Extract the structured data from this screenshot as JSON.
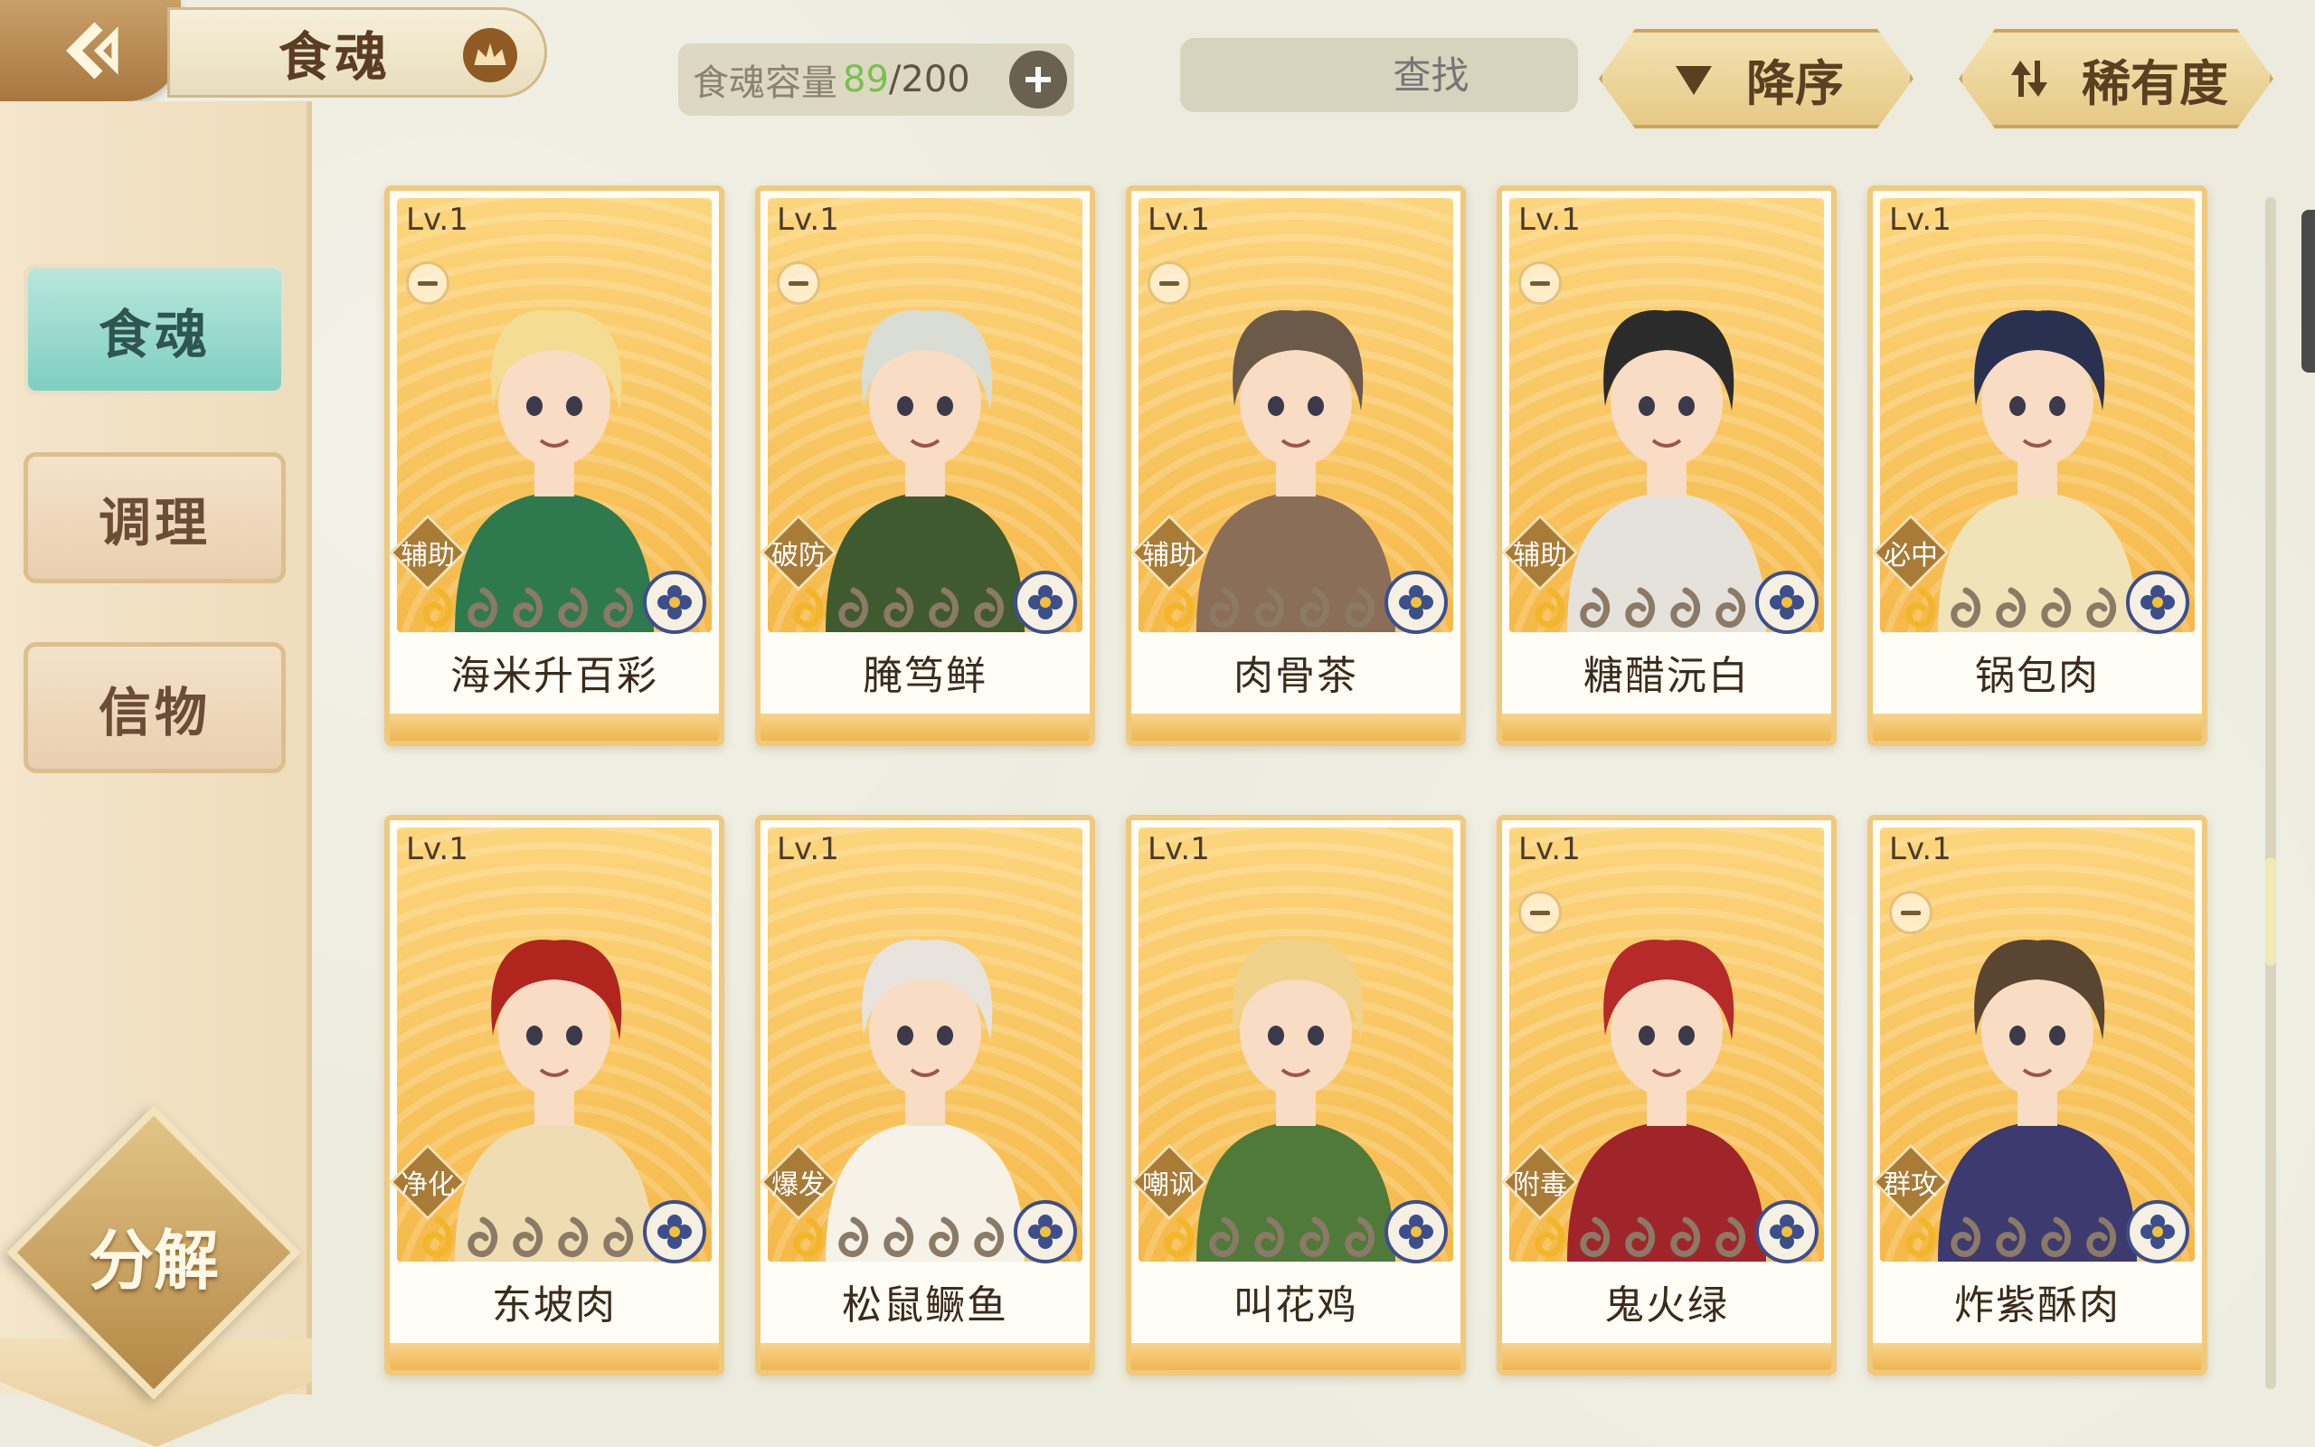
{
  "header": {
    "title": "食魂",
    "capacity_label": "食魂容量",
    "capacity_current": "89",
    "capacity_separator": "/",
    "capacity_max": "200",
    "search_placeholder": "查找",
    "sort_order_label": "降序",
    "sort_key_label": "稀有度"
  },
  "sidebar": {
    "tabs": [
      {
        "label": "食魂",
        "active": true
      },
      {
        "label": "调理",
        "active": false
      },
      {
        "label": "信物",
        "active": false
      }
    ],
    "decompose_label": "分解"
  },
  "cards": [
    {
      "level": "Lv.1",
      "name": "海米升百彩",
      "role": "辅助",
      "hair": "#f4dc92",
      "outfit": "#2e7a4e",
      "mark": true
    },
    {
      "level": "Lv.1",
      "name": "腌笃鲜",
      "role": "破防",
      "hair": "#d9ddd3",
      "outfit": "#3f5a2e",
      "mark": true
    },
    {
      "level": "Lv.1",
      "name": "肉骨茶",
      "role": "辅助",
      "hair": "#6b5a4a",
      "outfit": "#8a6e58",
      "mark": true
    },
    {
      "level": "Lv.1",
      "name": "糖醋沅白",
      "role": "辅助",
      "hair": "#2b2b2b",
      "outfit": "#e5e2dc",
      "mark": true
    },
    {
      "level": "Lv.1",
      "name": "锅包肉",
      "role": "必中",
      "hair": "#2a3150",
      "outfit": "#f1e3b8",
      "mark": false
    },
    {
      "level": "Lv.1",
      "name": "东坡肉",
      "role": "净化",
      "hair": "#b0261f",
      "outfit": "#f0dcb2",
      "mark": false
    },
    {
      "level": "Lv.1",
      "name": "松鼠鳜鱼",
      "role": "爆发",
      "hair": "#e8e3dc",
      "outfit": "#f6f2e8",
      "mark": false
    },
    {
      "level": "Lv.1",
      "name": "叫花鸡",
      "role": "嘲讽",
      "hair": "#f0d28a",
      "outfit": "#4f7a3a",
      "mark": false
    },
    {
      "level": "Lv.1",
      "name": "鬼火绿",
      "role": "附毒",
      "hair": "#b72a2a",
      "outfit": "#a0252b",
      "mark": true
    },
    {
      "level": "Lv.1",
      "name": "炸紫酥肉",
      "role": "群攻",
      "hair": "#5a4533",
      "outfit": "#3c3a6e",
      "mark": true
    }
  ],
  "colors": {
    "card_border": "#f1c97c",
    "active_tab": "#7fcfc1",
    "capacity_current": "#77c04e"
  },
  "icons": [
    "back-icon",
    "crown-icon",
    "plus-icon",
    "search-icon",
    "clear-icon",
    "sort-desc-icon",
    "sort-rarity-icon",
    "star-icon",
    "element-flower-icon"
  ]
}
